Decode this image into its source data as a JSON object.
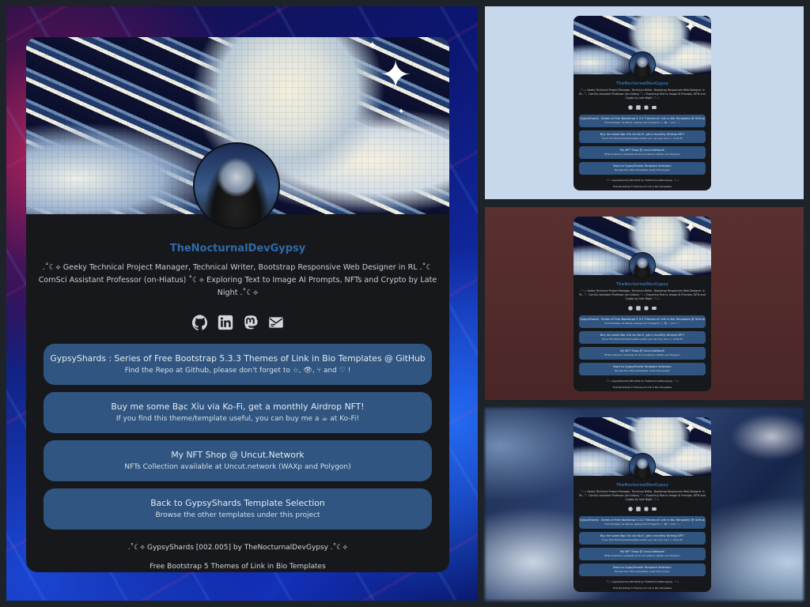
{
  "profile": {
    "name": "TheNocturnalDevGypsy",
    "bio": ".˚☾⟡ Geeky Technical Project Manager, Technical Writer, Bootstrap Responsive Web Designer in RL .˚☾ ComSci Assistant Professor (on-Hiatus) ˚☾⟡ Exploring Text to Image AI Prompts, NFTs and Crypto by Late Night .˚☾⟡"
  },
  "socials": [
    {
      "icon": "github-icon"
    },
    {
      "icon": "linkedin-icon"
    },
    {
      "icon": "mastodon-icon"
    },
    {
      "icon": "mail-icon"
    }
  ],
  "links": [
    {
      "title": "GypsyShards : Series of Free Bootstrap 5.3.3 Themes of Link in Bio Templates @ GitHub",
      "subtitle": "Find the Repo at Github, please don't forget to ☆, 👁, ⑂ and ♡ !"
    },
    {
      "title": "Buy me some Bạc Xỉu via Ko-Fi, get a monthly Airdrop NFT!",
      "subtitle": "If you find this theme/template useful, you can buy me a ☕ at Ko-Fi!"
    },
    {
      "title": "My NFT Shop @ Uncut.Network",
      "subtitle": "NFTs Collection available at Uncut.network (WAXp and Polygon)"
    },
    {
      "title": "Back to GypsyShards Template Selection",
      "subtitle": "Browse the other templates under this project"
    }
  ],
  "footer": {
    "line1": ".˚☾⟡ GypsyShards [002.005] by TheNocturnalDevGypsy .˚☾⟡",
    "line2": "Free Bootstrap 5 Themes of Link in Bio Templates"
  },
  "colors": {
    "card_bg": "#17181b",
    "accent": "#2f6aa8",
    "button_bg": "#2f5580",
    "preview_bg_light": "#c8d8ec",
    "preview_bg_maroon": "#4f2a2a"
  }
}
